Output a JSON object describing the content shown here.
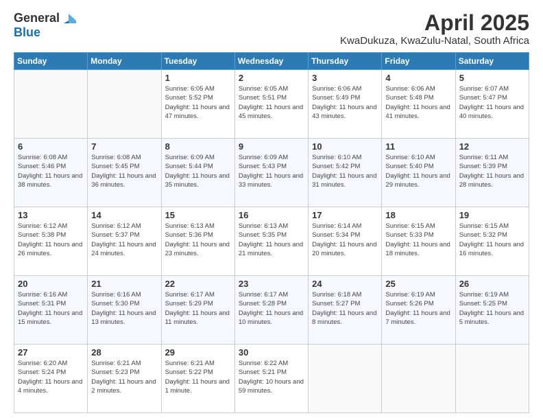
{
  "logo": {
    "general": "General",
    "blue": "Blue"
  },
  "title": "April 2025",
  "subtitle": "KwaDukuza, KwaZulu-Natal, South Africa",
  "weekdays": [
    "Sunday",
    "Monday",
    "Tuesday",
    "Wednesday",
    "Thursday",
    "Friday",
    "Saturday"
  ],
  "weeks": [
    [
      {
        "day": "",
        "sunrise": "",
        "sunset": "",
        "daylight": ""
      },
      {
        "day": "",
        "sunrise": "",
        "sunset": "",
        "daylight": ""
      },
      {
        "day": "1",
        "sunrise": "Sunrise: 6:05 AM",
        "sunset": "Sunset: 5:52 PM",
        "daylight": "Daylight: 11 hours and 47 minutes."
      },
      {
        "day": "2",
        "sunrise": "Sunrise: 6:05 AM",
        "sunset": "Sunset: 5:51 PM",
        "daylight": "Daylight: 11 hours and 45 minutes."
      },
      {
        "day": "3",
        "sunrise": "Sunrise: 6:06 AM",
        "sunset": "Sunset: 5:49 PM",
        "daylight": "Daylight: 11 hours and 43 minutes."
      },
      {
        "day": "4",
        "sunrise": "Sunrise: 6:06 AM",
        "sunset": "Sunset: 5:48 PM",
        "daylight": "Daylight: 11 hours and 41 minutes."
      },
      {
        "day": "5",
        "sunrise": "Sunrise: 6:07 AM",
        "sunset": "Sunset: 5:47 PM",
        "daylight": "Daylight: 11 hours and 40 minutes."
      }
    ],
    [
      {
        "day": "6",
        "sunrise": "Sunrise: 6:08 AM",
        "sunset": "Sunset: 5:46 PM",
        "daylight": "Daylight: 11 hours and 38 minutes."
      },
      {
        "day": "7",
        "sunrise": "Sunrise: 6:08 AM",
        "sunset": "Sunset: 5:45 PM",
        "daylight": "Daylight: 11 hours and 36 minutes."
      },
      {
        "day": "8",
        "sunrise": "Sunrise: 6:09 AM",
        "sunset": "Sunset: 5:44 PM",
        "daylight": "Daylight: 11 hours and 35 minutes."
      },
      {
        "day": "9",
        "sunrise": "Sunrise: 6:09 AM",
        "sunset": "Sunset: 5:43 PM",
        "daylight": "Daylight: 11 hours and 33 minutes."
      },
      {
        "day": "10",
        "sunrise": "Sunrise: 6:10 AM",
        "sunset": "Sunset: 5:42 PM",
        "daylight": "Daylight: 11 hours and 31 minutes."
      },
      {
        "day": "11",
        "sunrise": "Sunrise: 6:10 AM",
        "sunset": "Sunset: 5:40 PM",
        "daylight": "Daylight: 11 hours and 29 minutes."
      },
      {
        "day": "12",
        "sunrise": "Sunrise: 6:11 AM",
        "sunset": "Sunset: 5:39 PM",
        "daylight": "Daylight: 11 hours and 28 minutes."
      }
    ],
    [
      {
        "day": "13",
        "sunrise": "Sunrise: 6:12 AM",
        "sunset": "Sunset: 5:38 PM",
        "daylight": "Daylight: 11 hours and 26 minutes."
      },
      {
        "day": "14",
        "sunrise": "Sunrise: 6:12 AM",
        "sunset": "Sunset: 5:37 PM",
        "daylight": "Daylight: 11 hours and 24 minutes."
      },
      {
        "day": "15",
        "sunrise": "Sunrise: 6:13 AM",
        "sunset": "Sunset: 5:36 PM",
        "daylight": "Daylight: 11 hours and 23 minutes."
      },
      {
        "day": "16",
        "sunrise": "Sunrise: 6:13 AM",
        "sunset": "Sunset: 5:35 PM",
        "daylight": "Daylight: 11 hours and 21 minutes."
      },
      {
        "day": "17",
        "sunrise": "Sunrise: 6:14 AM",
        "sunset": "Sunset: 5:34 PM",
        "daylight": "Daylight: 11 hours and 20 minutes."
      },
      {
        "day": "18",
        "sunrise": "Sunrise: 6:15 AM",
        "sunset": "Sunset: 5:33 PM",
        "daylight": "Daylight: 11 hours and 18 minutes."
      },
      {
        "day": "19",
        "sunrise": "Sunrise: 6:15 AM",
        "sunset": "Sunset: 5:32 PM",
        "daylight": "Daylight: 11 hours and 16 minutes."
      }
    ],
    [
      {
        "day": "20",
        "sunrise": "Sunrise: 6:16 AM",
        "sunset": "Sunset: 5:31 PM",
        "daylight": "Daylight: 11 hours and 15 minutes."
      },
      {
        "day": "21",
        "sunrise": "Sunrise: 6:16 AM",
        "sunset": "Sunset: 5:30 PM",
        "daylight": "Daylight: 11 hours and 13 minutes."
      },
      {
        "day": "22",
        "sunrise": "Sunrise: 6:17 AM",
        "sunset": "Sunset: 5:29 PM",
        "daylight": "Daylight: 11 hours and 11 minutes."
      },
      {
        "day": "23",
        "sunrise": "Sunrise: 6:17 AM",
        "sunset": "Sunset: 5:28 PM",
        "daylight": "Daylight: 11 hours and 10 minutes."
      },
      {
        "day": "24",
        "sunrise": "Sunrise: 6:18 AM",
        "sunset": "Sunset: 5:27 PM",
        "daylight": "Daylight: 11 hours and 8 minutes."
      },
      {
        "day": "25",
        "sunrise": "Sunrise: 6:19 AM",
        "sunset": "Sunset: 5:26 PM",
        "daylight": "Daylight: 11 hours and 7 minutes."
      },
      {
        "day": "26",
        "sunrise": "Sunrise: 6:19 AM",
        "sunset": "Sunset: 5:25 PM",
        "daylight": "Daylight: 11 hours and 5 minutes."
      }
    ],
    [
      {
        "day": "27",
        "sunrise": "Sunrise: 6:20 AM",
        "sunset": "Sunset: 5:24 PM",
        "daylight": "Daylight: 11 hours and 4 minutes."
      },
      {
        "day": "28",
        "sunrise": "Sunrise: 6:21 AM",
        "sunset": "Sunset: 5:23 PM",
        "daylight": "Daylight: 11 hours and 2 minutes."
      },
      {
        "day": "29",
        "sunrise": "Sunrise: 6:21 AM",
        "sunset": "Sunset: 5:22 PM",
        "daylight": "Daylight: 11 hours and 1 minute."
      },
      {
        "day": "30",
        "sunrise": "Sunrise: 6:22 AM",
        "sunset": "Sunset: 5:21 PM",
        "daylight": "Daylight: 10 hours and 59 minutes."
      },
      {
        "day": "",
        "sunrise": "",
        "sunset": "",
        "daylight": ""
      },
      {
        "day": "",
        "sunrise": "",
        "sunset": "",
        "daylight": ""
      },
      {
        "day": "",
        "sunrise": "",
        "sunset": "",
        "daylight": ""
      }
    ]
  ]
}
